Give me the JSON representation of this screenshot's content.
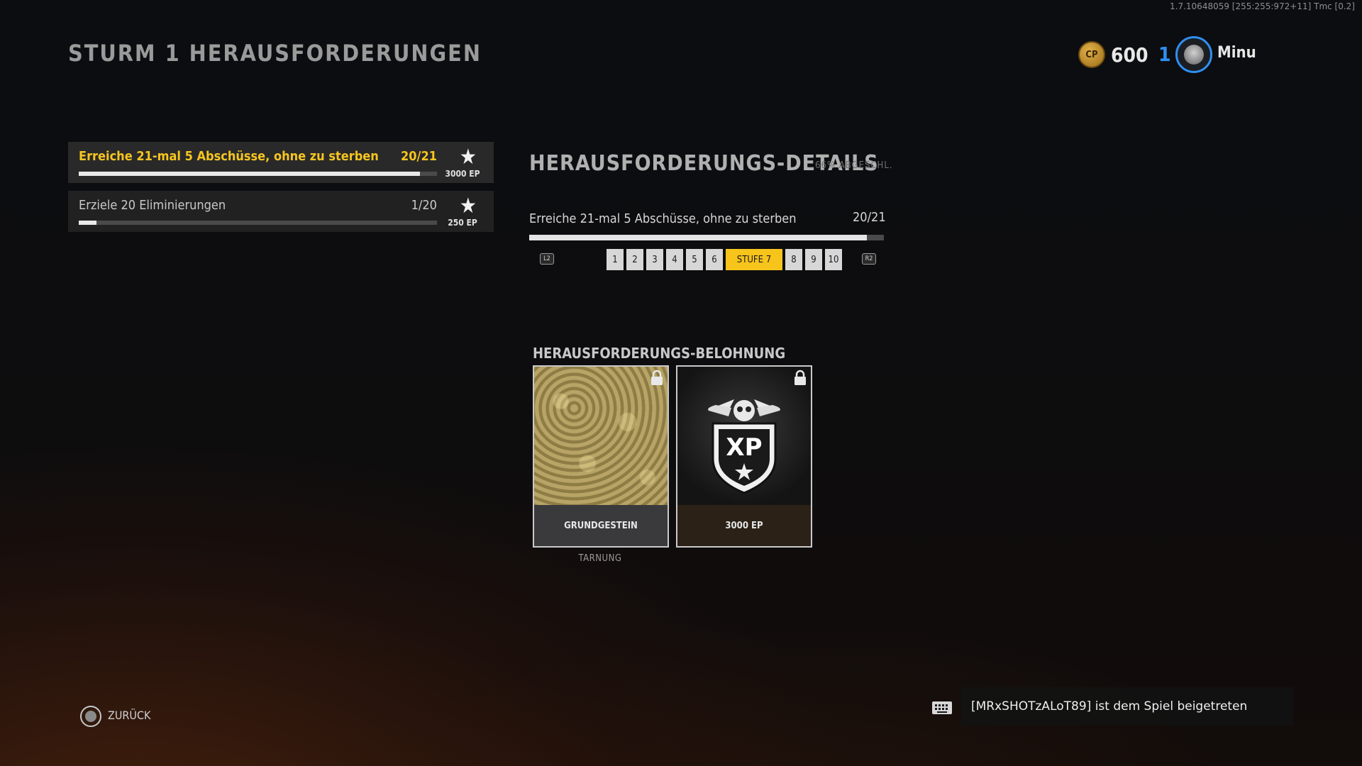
{
  "version": "1.7.10648059 [255:255:972+11] Tmc [0.2]",
  "header": {
    "title": "STURM 1 HERAUSFORDERUNGEN",
    "cp_icon_label": "CP",
    "cp_amount": "600",
    "rank": "1",
    "player_name": "Minu"
  },
  "challenges": [
    {
      "title": "Erreiche 21-mal 5 Abschüsse, ohne zu sterben",
      "count": "20/21",
      "progress": 0.952,
      "reward": "3000 EP",
      "selected": true
    },
    {
      "title": "Erziele 20 Eliminierungen",
      "count": "1/20",
      "progress": 0.05,
      "reward": "250 EP",
      "selected": false
    }
  ],
  "details": {
    "title": "HERAUSFORDERUNGS-DETAILS",
    "completion": "66% ABGESCHL.",
    "challenge": "Erreiche 21-mal 5 Abschüsse, ohne zu sterben",
    "count": "20/21",
    "progress": 0.952,
    "prev_button": "L2",
    "next_button": "R2",
    "tiers": [
      "1",
      "2",
      "3",
      "4",
      "5",
      "6",
      "STUFE 7",
      "8",
      "9",
      "10"
    ],
    "current_tier_index": 6
  },
  "rewards": {
    "title": "HERAUSFORDERUNGS-BELOHNUNG",
    "items": [
      {
        "label": "GRUNDGESTEIN",
        "category": "TARNUNG",
        "icon": "camo-pattern",
        "locked": true
      },
      {
        "label": "3000 EP",
        "icon": "xp-badge-icon",
        "icon_text": "XP",
        "locked": true
      }
    ]
  },
  "footer": {
    "back_label": "ZURÜCK",
    "back_icon": "circle-button-icon"
  },
  "notification": {
    "icon": "keyboard-icon",
    "text": "[MRxSHOTzALoT89] ist dem Spiel beigetreten"
  },
  "colors": {
    "accent_yellow": "#f6c51f",
    "rank_blue": "#2f8ff2",
    "progress_fill": "#e9e9e9"
  }
}
